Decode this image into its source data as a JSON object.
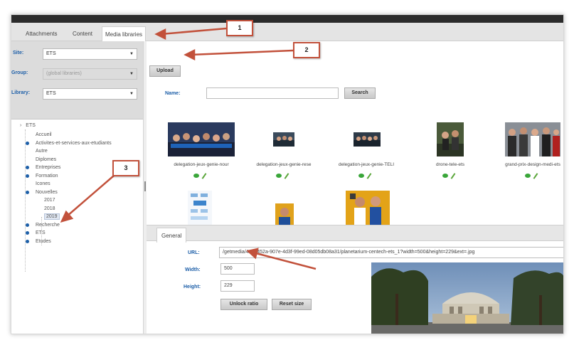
{
  "tabs": [
    {
      "label": "Attachments"
    },
    {
      "label": "Content"
    },
    {
      "label": "Media libraries",
      "active": true
    }
  ],
  "filters": {
    "site": {
      "label": "Site:",
      "value": "ETS"
    },
    "group": {
      "label": "Group:",
      "value": "(global libraries)"
    },
    "library": {
      "label": "Library:",
      "value": "ETS"
    }
  },
  "tree": {
    "root": "ETS",
    "items": [
      {
        "label": "Accueil",
        "dot": false
      },
      {
        "label": "Activites-et-services-aux-etudiants",
        "dot": true
      },
      {
        "label": "Autre",
        "dot": false
      },
      {
        "label": "Diplomes",
        "dot": false
      },
      {
        "label": "Entreprises",
        "dot": true
      },
      {
        "label": "Formation",
        "dot": true
      },
      {
        "label": "Icones",
        "dot": false
      },
      {
        "label": "Nouvelles",
        "dot": true
      },
      {
        "label": "2017",
        "dot": false,
        "child": true
      },
      {
        "label": "2018",
        "dot": false,
        "child": true
      },
      {
        "label": "2019",
        "dot": false,
        "child": true,
        "selected": true
      },
      {
        "label": "Recherche",
        "dot": true
      },
      {
        "label": "ETS",
        "dot": true
      },
      {
        "label": "Etudes",
        "dot": true
      }
    ]
  },
  "toolbar": {
    "upload_label": "Upload"
  },
  "search": {
    "name_label": "Name:",
    "value": "",
    "button_label": "Search"
  },
  "media": [
    {
      "caption": "delegation-jeux-genie-nour"
    },
    {
      "caption": "delegation-jeux-genie-rese"
    },
    {
      "caption": "delegation-jeux-genie-TELI"
    },
    {
      "caption": "drone-tele-ets"
    },
    {
      "caption": "grand-prix-design-medi-ets"
    }
  ],
  "properties": {
    "tab_label": "General",
    "url_label": "URL:",
    "url_value": "/getmedia/44e5452a-907e-4d3f-99ed-08d05db08a31/planetarium-centech-ets_1?width=500&height=229&ext=.jpg",
    "width_label": "Width:",
    "width_value": "500",
    "height_label": "Height:",
    "height_value": "229",
    "unlock_label": "Unlock ratio",
    "reset_label": "Reset size"
  },
  "callouts": [
    "1",
    "2",
    "3"
  ],
  "colors": {
    "accent": "#1c5ea8",
    "annotation": "#c2513b"
  }
}
